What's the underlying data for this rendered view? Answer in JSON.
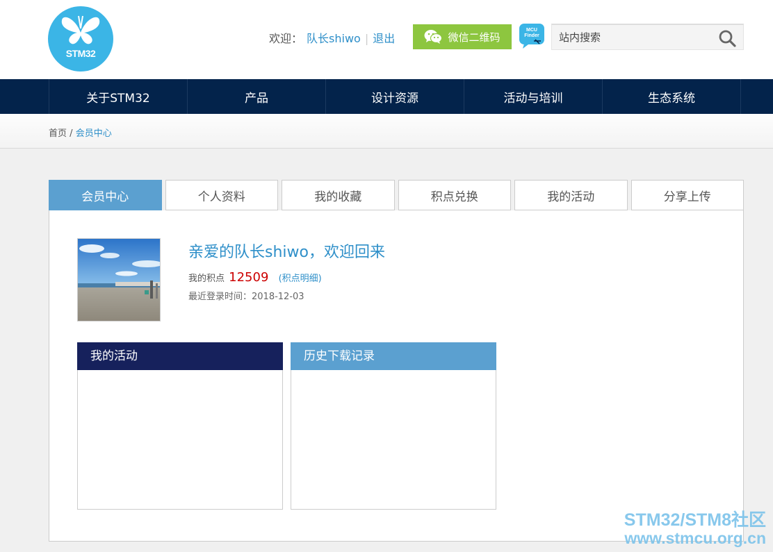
{
  "header": {
    "logo_text": "STM32",
    "welcome_label": "欢迎：",
    "username": "队长shiwo",
    "separator": "|",
    "logout": "退出",
    "wechat_button": "微信二维码",
    "mcu_finder_label_1": "MCU",
    "mcu_finder_label_2": "Finder",
    "search_placeholder": "站内搜索"
  },
  "nav": {
    "items": [
      "关于STM32",
      "产品",
      "设计资源",
      "活动与培训",
      "生态系统"
    ]
  },
  "breadcrumb": {
    "home": "首页",
    "sep": "/",
    "current": "会员中心"
  },
  "tabs": [
    "会员中心",
    "个人资料",
    "我的收藏",
    "积点兑换",
    "我的活动",
    "分享上传"
  ],
  "profile": {
    "greeting": "亲爱的队长shiwo，欢迎回来",
    "points_label": "我的积点",
    "points_value": "12509",
    "points_detail": "(积点明细)",
    "last_login": "最近登录时间：2018-12-03"
  },
  "boxes": {
    "activity_title": "我的活动",
    "downloads_title": "历史下载记录"
  },
  "watermark": {
    "line1": "STM32/STM8社区",
    "line2": "www.stmcu.org.cn"
  },
  "colors": {
    "nav_bg": "#03234b",
    "accent_blue": "#2e8fc9",
    "tab_active": "#5ba0d0",
    "wechat_green": "#8dc63f",
    "points_red": "#cc0000"
  }
}
